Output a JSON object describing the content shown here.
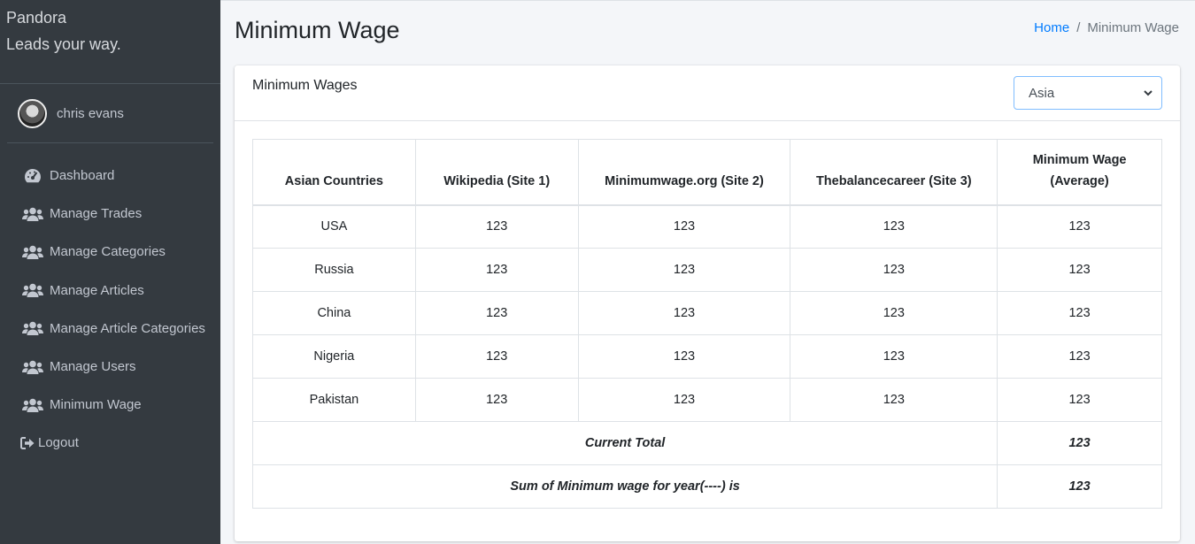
{
  "brand": {
    "title": "Pandora",
    "tagline": "Leads your way."
  },
  "user": {
    "name": "chris evans"
  },
  "sidebar": {
    "items": [
      {
        "label": "Dashboard",
        "icon": "tachometer-icon"
      },
      {
        "label": "Manage Trades",
        "icon": "users-icon"
      },
      {
        "label": "Manage Categories",
        "icon": "users-icon"
      },
      {
        "label": "Manage Articles",
        "icon": "users-icon"
      },
      {
        "label": "Manage Article Categories",
        "icon": "users-icon"
      },
      {
        "label": "Manage Users",
        "icon": "users-icon"
      },
      {
        "label": "Minimum Wage",
        "icon": "users-icon"
      },
      {
        "label": "Logout",
        "icon": "sign-out-icon"
      }
    ]
  },
  "header": {
    "title": "Minimum Wage",
    "breadcrumb": {
      "home": "Home",
      "separator": "/",
      "current": "Minimum Wage"
    }
  },
  "card": {
    "title": "Minimum Wages",
    "region_select": {
      "value": "Asia"
    }
  },
  "table": {
    "headers": [
      "Asian Countries",
      "Wikipedia (Site 1)",
      "Minimumwage.org (Site 2)",
      "Thebalancecareer (Site 3)",
      "Minimum Wage",
      "(Average)"
    ],
    "rows": [
      [
        "USA",
        "123",
        "123",
        "123",
        "123"
      ],
      [
        "Russia",
        "123",
        "123",
        "123",
        "123"
      ],
      [
        "China",
        "123",
        "123",
        "123",
        "123"
      ],
      [
        "Nigeria",
        "123",
        "123",
        "123",
        "123"
      ],
      [
        "Pakistan",
        "123",
        "123",
        "123",
        "123"
      ]
    ],
    "current_total": {
      "label": "Current Total",
      "value": "123"
    },
    "year_sum": {
      "label": "Sum of Minimum wage for year(----) is",
      "value": "123"
    }
  },
  "colors": {
    "sidebar_bg": "#343a40",
    "link": "#007bff",
    "page_bg": "#f4f6f9"
  }
}
